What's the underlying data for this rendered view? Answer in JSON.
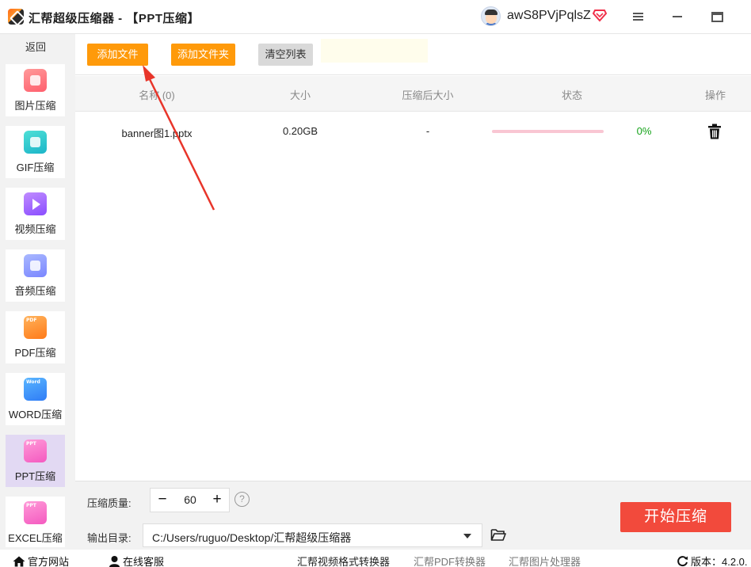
{
  "window": {
    "title": "汇帮超级压缩器  - 【PPT压缩】",
    "username": "awS8PVjPqlsZ"
  },
  "sidebar": {
    "back_label": "返回",
    "items": [
      {
        "label": "图片压缩",
        "icon": "image-icon"
      },
      {
        "label": "GIF压缩",
        "icon": "gif-icon"
      },
      {
        "label": "视频压缩",
        "icon": "video-icon"
      },
      {
        "label": "音频压缩",
        "icon": "audio-icon"
      },
      {
        "label": "PDF压缩",
        "icon": "pdf-icon",
        "tag": "PDF"
      },
      {
        "label": "WORD压缩",
        "icon": "word-icon",
        "tag": "Word"
      },
      {
        "label": "PPT压缩",
        "icon": "ppt-icon",
        "tag": "PPT",
        "active": true
      },
      {
        "label": "EXCEL压缩",
        "icon": "excel-icon",
        "tag": "PPT"
      }
    ]
  },
  "toolbar": {
    "add_file": "添加文件",
    "add_folder": "添加文件夹",
    "clear_list": "清空列表"
  },
  "table": {
    "columns": [
      "名称 (0)",
      "大小",
      "压缩后大小",
      "状态",
      "操作"
    ],
    "rows": [
      {
        "name": "banner图1.pptx",
        "size": "0.20GB",
        "compressed_size": "-",
        "progress": 0,
        "progress_label": "0%"
      }
    ]
  },
  "settings": {
    "quality_label": "压缩质量:",
    "quality_value": "60",
    "minus": "−",
    "plus": "+",
    "help": "?",
    "output_label": "输出目录:",
    "output_path": "C:/Users/ruguo/Desktop/汇帮超级压缩器",
    "start_label": "开始压缩"
  },
  "statusbar": {
    "official_site": "官方网站",
    "online_support": "在线客服",
    "video_converter": "汇帮视频格式转换器",
    "pdf_converter": "汇帮PDF转换器",
    "image_processor": "汇帮图片处理器",
    "version": "版本：4.2.0."
  },
  "colors": {
    "accent_orange": "#ff9a0a",
    "start_red": "#f24a3c",
    "progress_pink": "#f9c6d3",
    "progress_text_green": "#15a31a",
    "sidebar_active": "#e2d9f3"
  }
}
